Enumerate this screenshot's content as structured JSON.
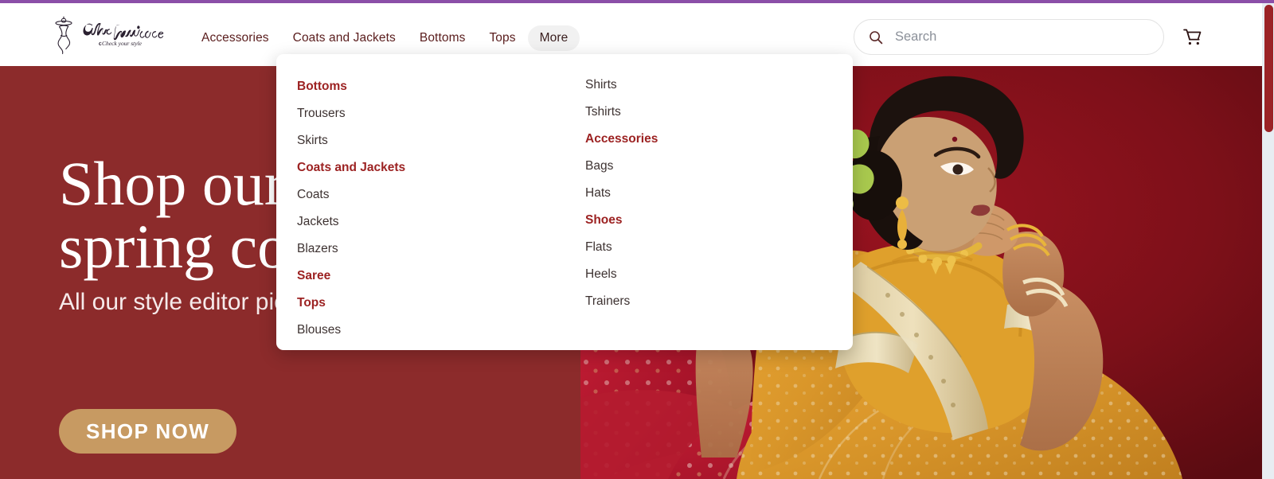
{
  "browser": {
    "accent_border_color": "#8b4fa8",
    "scrollbar": {
      "track_color": "#e8edf2",
      "thumb_color": "#9b2226"
    }
  },
  "brand": {
    "name": "Chic Boutique",
    "tagline": "Check your style",
    "logo_icon": "dress-form-mannequin-icon"
  },
  "nav": {
    "items": [
      {
        "label": "Accessories",
        "active": false
      },
      {
        "label": "Coats and Jackets",
        "active": false
      },
      {
        "label": "Bottoms",
        "active": false
      },
      {
        "label": "Tops",
        "active": false
      },
      {
        "label": "More",
        "active": true
      }
    ]
  },
  "search": {
    "placeholder": "Search",
    "value": "",
    "icon": "search-icon"
  },
  "cart": {
    "icon": "shopping-cart-icon",
    "label": "Cart"
  },
  "mega_menu": {
    "visible": true,
    "header_color": "#9c2222",
    "link_color": "#3d3231",
    "columns": [
      {
        "entries": [
          {
            "type": "header",
            "label": "Bottoms"
          },
          {
            "type": "link",
            "label": "Trousers"
          },
          {
            "type": "link",
            "label": "Skirts"
          },
          {
            "type": "header",
            "label": "Coats and Jackets"
          },
          {
            "type": "link",
            "label": "Coats"
          },
          {
            "type": "link",
            "label": "Jackets"
          },
          {
            "type": "link",
            "label": "Blazers"
          },
          {
            "type": "header",
            "label": "Saree"
          },
          {
            "type": "header",
            "label": "Tops"
          },
          {
            "type": "link",
            "label": "Blouses"
          }
        ]
      },
      {
        "entries": [
          {
            "type": "link",
            "label": "Shirts"
          },
          {
            "type": "link",
            "label": "Tshirts"
          },
          {
            "type": "header",
            "label": "Accessories"
          },
          {
            "type": "link",
            "label": "Bags"
          },
          {
            "type": "link",
            "label": "Hats"
          },
          {
            "type": "header",
            "label": "Shoes"
          },
          {
            "type": "link",
            "label": "Flats"
          },
          {
            "type": "link",
            "label": "Heels"
          },
          {
            "type": "link",
            "label": "Trainers"
          }
        ]
      }
    ]
  },
  "hero": {
    "background_color": "#8c2b2b",
    "title_line1": "Shop our",
    "title_line2": "spring collection",
    "subtitle": "All our style editor picks",
    "cta_label": "SHOP NOW",
    "cta_color": "#c79a62",
    "photo_alt": "Woman in a mustard-gold saree seated against a deep red backdrop"
  }
}
